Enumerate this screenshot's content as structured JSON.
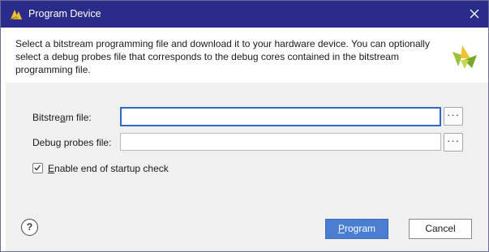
{
  "window": {
    "title": "Program Device",
    "close_icon": "close-icon"
  },
  "header": {
    "description": "Select a bitstream programming file and download it to your hardware device. You can optionally select a debug probes file that corresponds to the debug cores contained in the bitstream programming file.",
    "logo": "vivado-logo"
  },
  "form": {
    "bitstream": {
      "label_pre": "Bitstre",
      "label_mnemonic": "a",
      "label_post": "m file:",
      "value": "",
      "browse_label": "···"
    },
    "debug_probes": {
      "label_pre": "Debu",
      "label_mnemonic": "g",
      "label_post": " probes file:",
      "value": "",
      "browse_label": "···"
    },
    "startup_check": {
      "label_mnemonic": "E",
      "label_post": "nable end of startup check",
      "checked": true
    }
  },
  "footer": {
    "help_label": "?",
    "program_mnemonic": "P",
    "program_post": "rogram",
    "cancel_label": "Cancel"
  },
  "colors": {
    "titlebar": "#2b2b8a",
    "primary_button": "#4a7ed1",
    "focus_border": "#2f6bc6"
  }
}
